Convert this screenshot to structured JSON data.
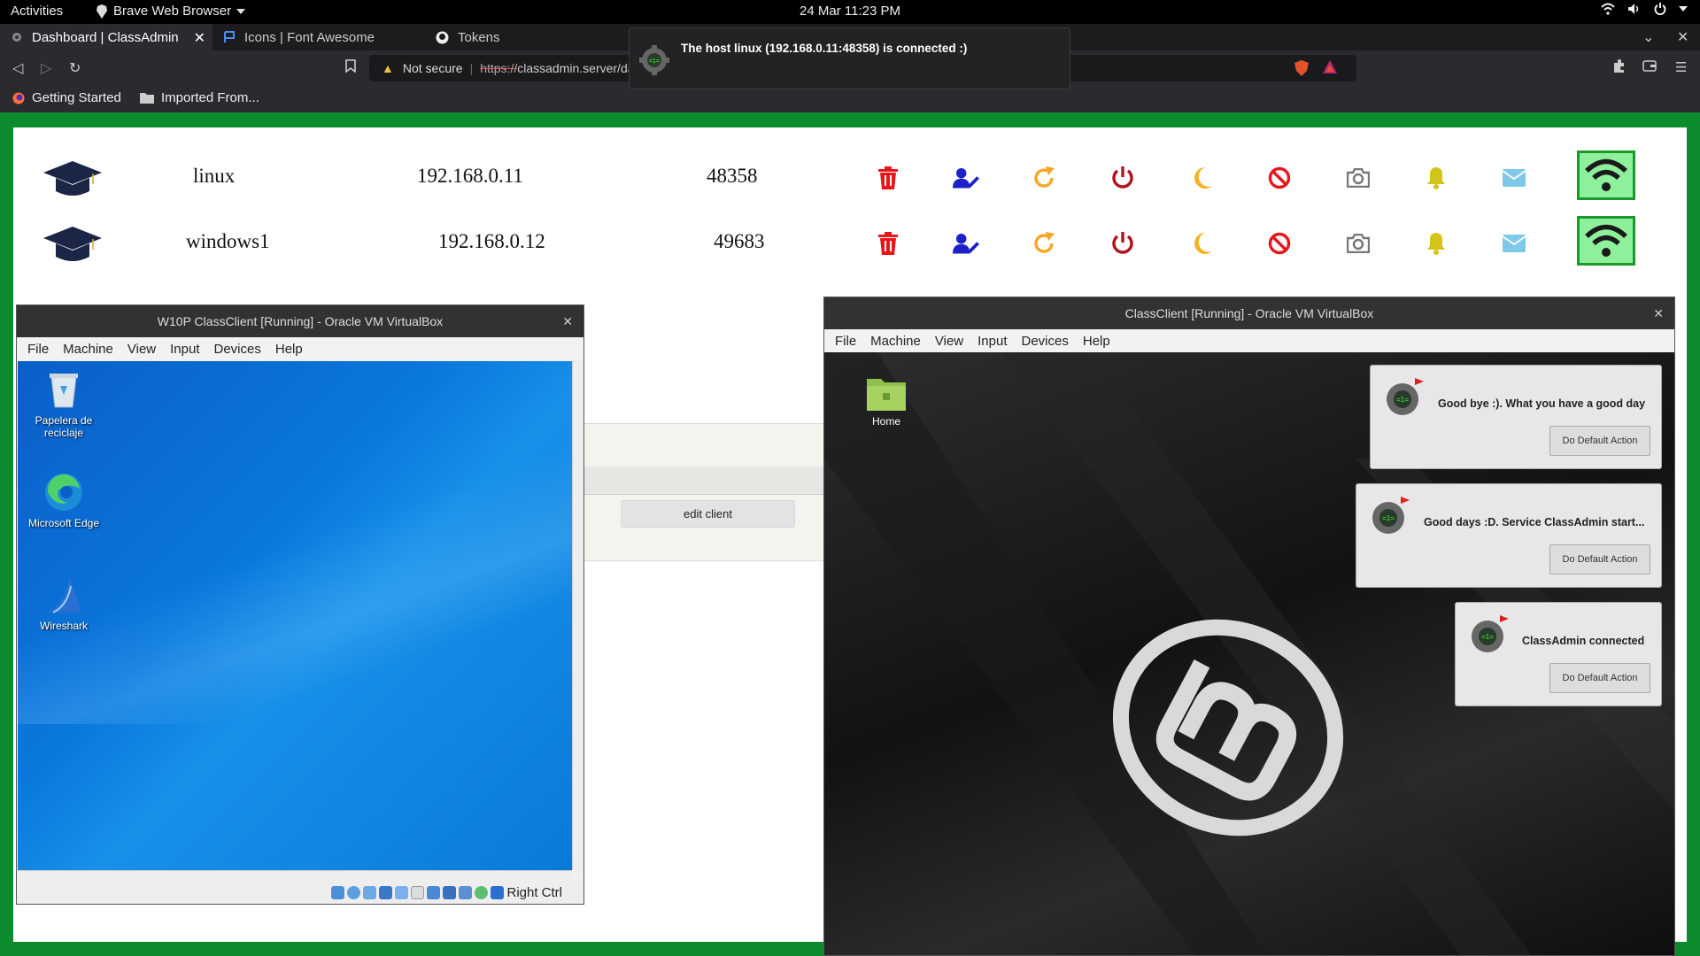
{
  "system": {
    "activities": "Activities",
    "app_name": "Brave Web Browser",
    "clock": "24 Mar  11:23 PM"
  },
  "browser": {
    "tabs": [
      {
        "label": "Dashboard | ClassAdmin"
      },
      {
        "label": "Icons | Font Awesome"
      },
      {
        "label": "Tokens"
      }
    ],
    "url": {
      "security_label": "Not secure",
      "protocol": "https://",
      "host": "classadmin.server/da"
    },
    "bookmarks": [
      {
        "label": "Getting Started"
      },
      {
        "label": "Imported From..."
      }
    ],
    "toast": "The host linux (192.168.0.11:48358) is connected :)"
  },
  "dashboard": {
    "clients": [
      {
        "name": "linux",
        "ip": "192.168.0.11",
        "port": "48358"
      },
      {
        "name": "windows1",
        "ip": "192.168.0.12",
        "port": "49683"
      }
    ],
    "actions": [
      "delete-icon",
      "user-edit-icon",
      "redo-icon",
      "power-icon",
      "moon-icon",
      "ban-icon",
      "camera-icon",
      "bell-icon",
      "envelope-icon"
    ],
    "edit_client": "edit client",
    "colors": {
      "delete": "#e8151b",
      "user": "#1c22c8",
      "redo": "#f5a623",
      "power": "#b0121a",
      "moon": "#f5b21c",
      "ban": "#e8151b",
      "camera": "#777777",
      "bell": "#d4c41a",
      "envelope": "#7ec8e8",
      "wifi_bg": "#8ef09a"
    }
  },
  "vbox_left": {
    "title": "W10P ClassClient [Running] - Oracle VM VirtualBox",
    "menu": [
      "File",
      "Machine",
      "View",
      "Input",
      "Devices",
      "Help"
    ],
    "desktop_icons": [
      {
        "label": "Papelera de reciclaje"
      },
      {
        "label": "Microsoft Edge"
      },
      {
        "label": "Wireshark"
      }
    ],
    "host_key": "Right Ctrl"
  },
  "vbox_right": {
    "title": "ClassClient [Running] - Oracle VM VirtualBox",
    "menu": [
      "File",
      "Machine",
      "View",
      "Input",
      "Devices",
      "Help"
    ],
    "home_label": "Home",
    "notifications": [
      {
        "text": "Good bye :). What you have a good day",
        "button": "Do Default Action"
      },
      {
        "text": "Good days :D. Service ClassAdmin start...",
        "button": "Do Default Action"
      },
      {
        "text": "ClassAdmin connected",
        "button": "Do Default Action"
      }
    ]
  }
}
